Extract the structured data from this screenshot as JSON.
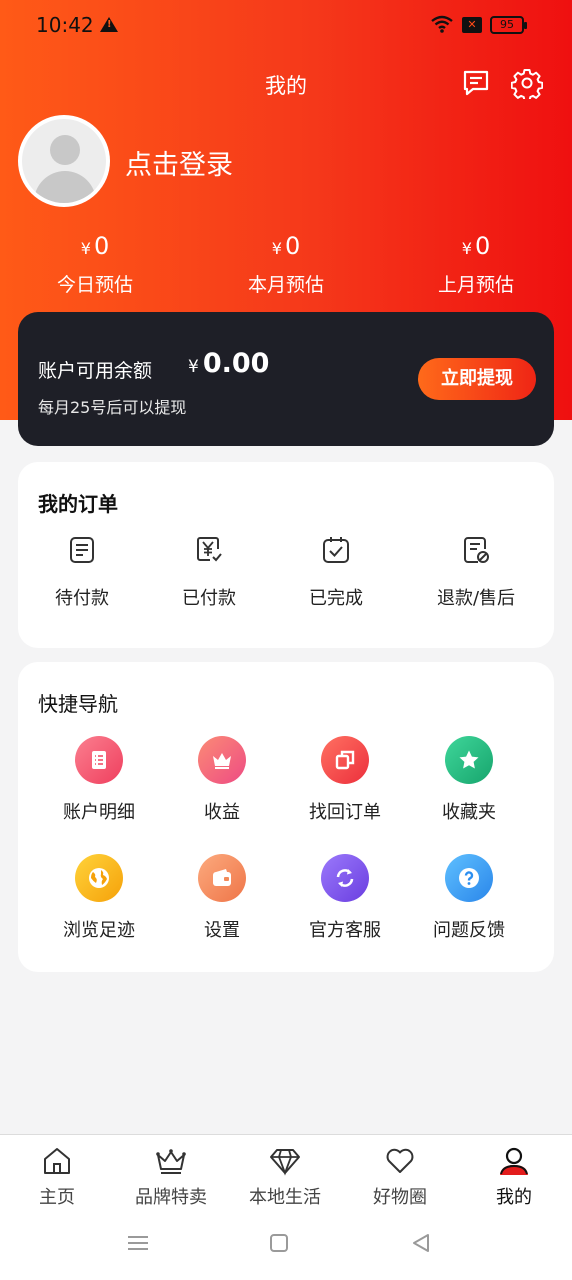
{
  "status_bar": {
    "time": "10:42",
    "battery": "95"
  },
  "header": {
    "title": "我的"
  },
  "profile": {
    "login_text": "点击登录"
  },
  "stats": [
    {
      "currency": "¥",
      "amount": "0",
      "label": "今日预估"
    },
    {
      "currency": "¥",
      "amount": "0",
      "label": "本月预估"
    },
    {
      "currency": "¥",
      "amount": "0",
      "label": "上月预估"
    }
  ],
  "balance": {
    "label": "账户可用余额",
    "currency": "¥",
    "amount": "0.00",
    "note": "每月25号后可以提现",
    "withdraw_label": "立即提现"
  },
  "orders": {
    "title": "我的订单",
    "items": [
      {
        "label": "待付款",
        "icon": "pending-payment-icon"
      },
      {
        "label": "已付款",
        "icon": "paid-icon"
      },
      {
        "label": "已完成",
        "icon": "completed-icon"
      },
      {
        "label": "退款/售后",
        "icon": "refund-icon"
      }
    ]
  },
  "quick_nav": {
    "title": "快捷导航",
    "items": [
      {
        "label": "账户明细",
        "icon": "account-detail-icon",
        "color": "#f2566e"
      },
      {
        "label": "收益",
        "icon": "crown-icon",
        "color": "#f0507a"
      },
      {
        "label": "找回订单",
        "icon": "retrieve-order-icon",
        "color": "#f24748"
      },
      {
        "label": "收藏夹",
        "icon": "star-icon",
        "color": "#21b57c"
      },
      {
        "label": "浏览足迹",
        "icon": "globe-icon",
        "color": "#f7b511"
      },
      {
        "label": "设置",
        "icon": "wallet-icon",
        "color": "#f28a5a"
      },
      {
        "label": "官方客服",
        "icon": "refresh-icon",
        "color": "#7d55e8"
      },
      {
        "label": "问题反馈",
        "icon": "question-icon",
        "color": "#3a9ef5"
      }
    ]
  },
  "tabbar": {
    "items": [
      {
        "label": "主页",
        "icon": "home-icon"
      },
      {
        "label": "品牌特卖",
        "icon": "crown-icon"
      },
      {
        "label": "本地生活",
        "icon": "diamond-icon"
      },
      {
        "label": "好物圈",
        "icon": "heart-icon"
      },
      {
        "label": "我的",
        "icon": "user-icon",
        "active": true
      }
    ],
    "accent": "#e31c1c"
  }
}
